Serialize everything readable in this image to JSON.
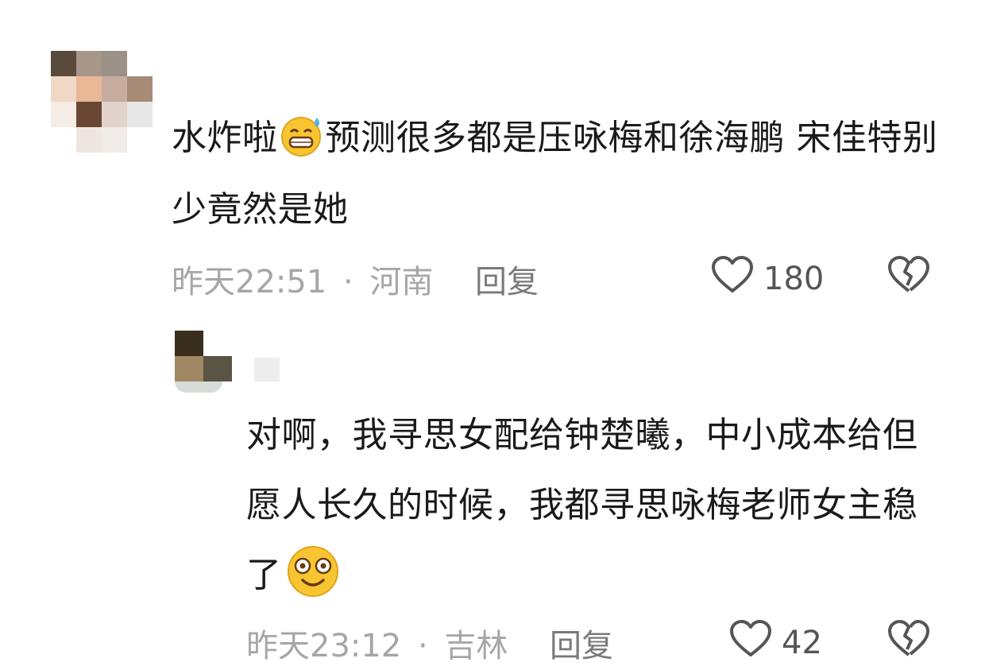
{
  "comment": {
    "text_before_emoji": "水炸啦",
    "emoji": "sweat-grin-emoji",
    "text_after_emoji": "预测很多都是压咏梅和徐海鹏 宋佳特别少竟然是她",
    "time": "昨天22:51",
    "separator": "·",
    "location": "河南",
    "reply_label": "回复",
    "likes": "180"
  },
  "reply": {
    "text": "对啊，我寻思女配给钟楚曦，中小成本给但愿人长久的时候，我都寻思咏梅老师女主稳了",
    "emoji": "dazed-smile-emoji",
    "time": "昨天23:12",
    "separator": "·",
    "location": "吉林",
    "reply_label": "回复",
    "likes": "42"
  },
  "colors": {
    "meta": "#a6a6a6",
    "text": "#1a1a1a",
    "emoji_yellow": "#f7c531"
  }
}
